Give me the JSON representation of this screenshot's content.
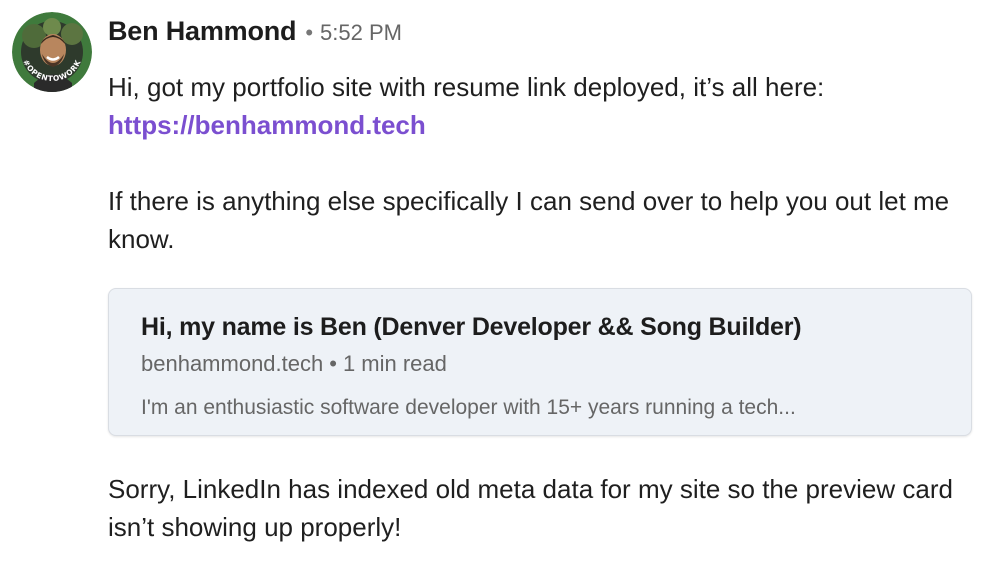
{
  "sender": {
    "name": "Ben Hammond",
    "separator": "•",
    "time": "5:52 PM",
    "avatar_badge": "#OPENTOWORK",
    "avatar_badge_color": "#3f7a3c"
  },
  "message": {
    "line1": "Hi, got my portfolio site with resume link deployed, it’s all here:",
    "link": "https://benhammond.tech",
    "line2": "If there is anything else specifically I can send over to help you out let me know.",
    "link_color": "#7b4fd0"
  },
  "preview_card": {
    "title": "Hi, my name is Ben (Denver Developer && Song Builder)",
    "domain": "benhammond.tech",
    "separator": "•",
    "read_time": "1 min read",
    "description": "I'm an enthusiastic software developer with 15+ years running a tech..."
  },
  "followup": {
    "text": "Sorry, LinkedIn has indexed old meta data for my site so the preview card isn’t showing up properly!"
  }
}
